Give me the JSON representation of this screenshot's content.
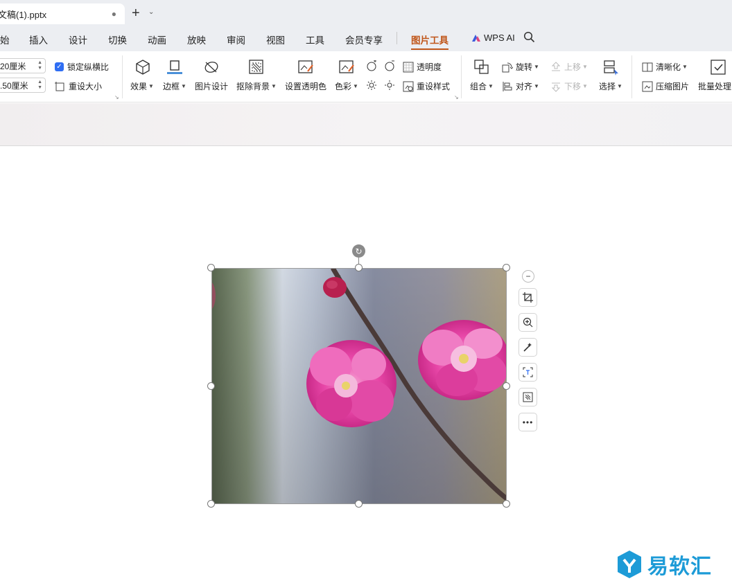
{
  "tab": {
    "filename": "文稿(1).pptx",
    "modified_dot": "●",
    "new_tab": "+",
    "dropdown": "⌄"
  },
  "menu": {
    "items": [
      "始",
      "插入",
      "设计",
      "切换",
      "动画",
      "放映",
      "审阅",
      "视图",
      "工具",
      "会员专享",
      "图片工具"
    ],
    "active": "图片工具",
    "wps_ai": "WPS AI"
  },
  "ribbon": {
    "height_value": "20厘米",
    "width_value": ".50厘米",
    "lock_ratio": "锁定纵横比",
    "reset_size": "重设大小",
    "effects": "效果",
    "border": "边框",
    "picture_design": "图片设计",
    "remove_bg": "抠除背景",
    "set_transparent": "设置透明色",
    "color": "色彩",
    "transparency": "透明度",
    "reset_style": "重设样式",
    "group": "组合",
    "rotate": "旋转",
    "align": "对齐",
    "bring_forward": "上移",
    "send_backward": "下移",
    "select": "选择",
    "sharpen": "清晰化",
    "compress": "压缩图片",
    "batch": "批量处理"
  },
  "watermark": {
    "text": "易软汇"
  },
  "colors": {
    "accent": "#c0561a",
    "checkbox": "#2f6ef3",
    "watermark": "#1d9bd7"
  }
}
